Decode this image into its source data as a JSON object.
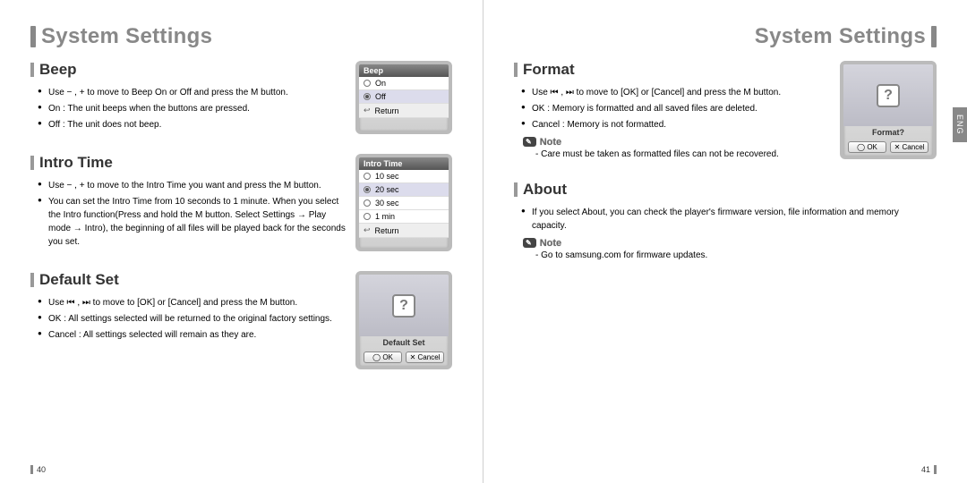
{
  "lang_tab": "ENG",
  "left_page": {
    "title": "System Settings",
    "page_number": "40",
    "sections": {
      "beep": {
        "heading": "Beep",
        "bullets": [
          "Use − , + to move to Beep On or Off and press the  M  button.",
          "On : The unit beeps when the buttons are pressed.",
          "Off : The unit does not beep."
        ],
        "screenshot": {
          "header": "Beep",
          "items": [
            "On",
            "Off"
          ],
          "selected_index": 1,
          "return_label": "Return"
        }
      },
      "intro": {
        "heading": "Intro Time",
        "bullets": [
          "Use − , + to move to the Intro Time you want and press the  M  button.",
          "You can set the Intro Time from 10 seconds to 1 minute. When you select the Intro function(Press and hold the  M  button. Select Settings → Play mode → Intro), the beginning of all files will be played back for the seconds you set."
        ],
        "screenshot": {
          "header": "Intro Time",
          "items": [
            "10 sec",
            "20 sec",
            "30 sec",
            "1 min"
          ],
          "selected_index": 1,
          "return_label": "Return"
        }
      },
      "default": {
        "heading": "Default Set",
        "bullets": [
          "Use ⏮ , ⏭ to move to [OK] or [Cancel] and press the  M  button.",
          "OK : All settings selected will be returned to the original factory settings.",
          "Cancel : All settings selected will remain as they are."
        ],
        "screenshot": {
          "label": "Default Set",
          "ok": "OK",
          "cancel": "Cancel"
        }
      }
    }
  },
  "right_page": {
    "title": "System Settings",
    "page_number": "41",
    "sections": {
      "format": {
        "heading": "Format",
        "bullets": [
          "Use ⏮ , ⏭ to move to [OK] or [Cancel] and press the  M  button.",
          "OK : Memory is formatted and all saved files are deleted.",
          "Cancel : Memory is not formatted."
        ],
        "note_label": "Note",
        "note_text": "- Care must be taken as formatted files can not be recovered.",
        "screenshot": {
          "label": "Format?",
          "ok": "OK",
          "cancel": "Cancel"
        }
      },
      "about": {
        "heading": "About",
        "bullets": [
          "If you select About, you can check the player's firmware version, file information and memory capacity."
        ],
        "note_label": "Note",
        "note_text": "- Go to samsung.com for firmware updates."
      }
    }
  }
}
